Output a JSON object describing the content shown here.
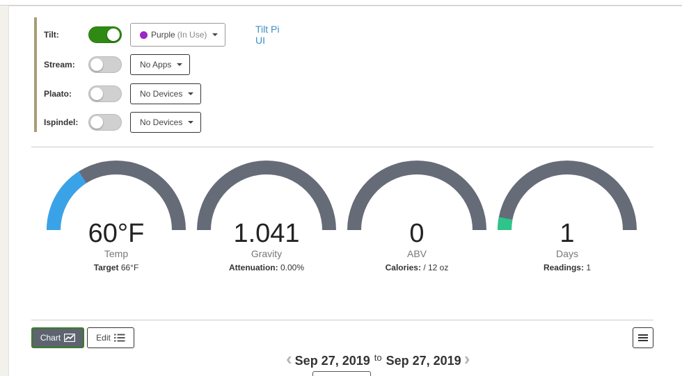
{
  "devices": [
    {
      "label": "Tilt:",
      "enabled": true,
      "selection": "Purple",
      "selection_note": "(In Use)",
      "dot_color": "#9b27c4",
      "link": "Tilt Pi UI"
    },
    {
      "label": "Stream:",
      "enabled": false,
      "selection": "No Apps"
    },
    {
      "label": "Plaato:",
      "enabled": false,
      "selection": "No Devices"
    },
    {
      "label": "Ispindel:",
      "enabled": false,
      "selection": "No Devices"
    }
  ],
  "gauges": [
    {
      "value": "60°F",
      "label": "Temp",
      "sub_label": "Target",
      "sub_value": "66°F",
      "fill_fraction": 0.32,
      "fill_color": "#3aa3e8"
    },
    {
      "value": "1.041",
      "label": "Gravity",
      "sub_label": "Attenuation:",
      "sub_value": "0.00%",
      "fill_fraction": 0,
      "fill_color": "#3aa3e8"
    },
    {
      "value": "0",
      "label": "ABV",
      "sub_label": "Calories:",
      "sub_value": "/ 12 oz",
      "fill_fraction": 0,
      "fill_color": "#3aa3e8"
    },
    {
      "value": "1",
      "label": "Days",
      "sub_label": "Readings:",
      "sub_value": "1",
      "fill_fraction": 0.06,
      "fill_color": "#2ec48a"
    }
  ],
  "gauge_track_color": "#666b78",
  "toolbar": {
    "chart_label": "Chart",
    "edit_label": "Edit"
  },
  "date_range": {
    "start": "Sep 27, 2019",
    "to": "to",
    "end": "Sep 27, 2019"
  }
}
